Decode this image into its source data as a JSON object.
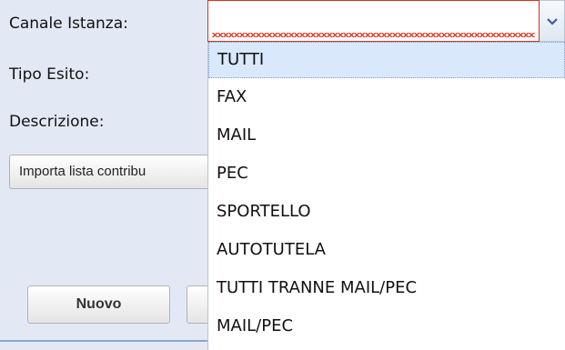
{
  "form": {
    "canale_label": "Canale Istanza:",
    "tipo_label": "Tipo Esito:",
    "descrizione_label": "Descrizione:",
    "canale_value": "",
    "importa_button": "Importa lista contribu",
    "nuovo_button": "Nuovo"
  },
  "dropdown": {
    "options": [
      "TUTTI",
      "FAX",
      "MAIL",
      "PEC",
      "SPORTELLO",
      "AUTOTUTELA",
      "TUTTI TRANNE MAIL/PEC",
      "MAIL/PEC"
    ],
    "highlighted": "TUTTI"
  },
  "icons": {
    "trigger": "chevron-down-icon"
  },
  "colors": {
    "error": "#d8301f",
    "highlight": "#d9e8fb",
    "background": "#e3e9f4"
  }
}
